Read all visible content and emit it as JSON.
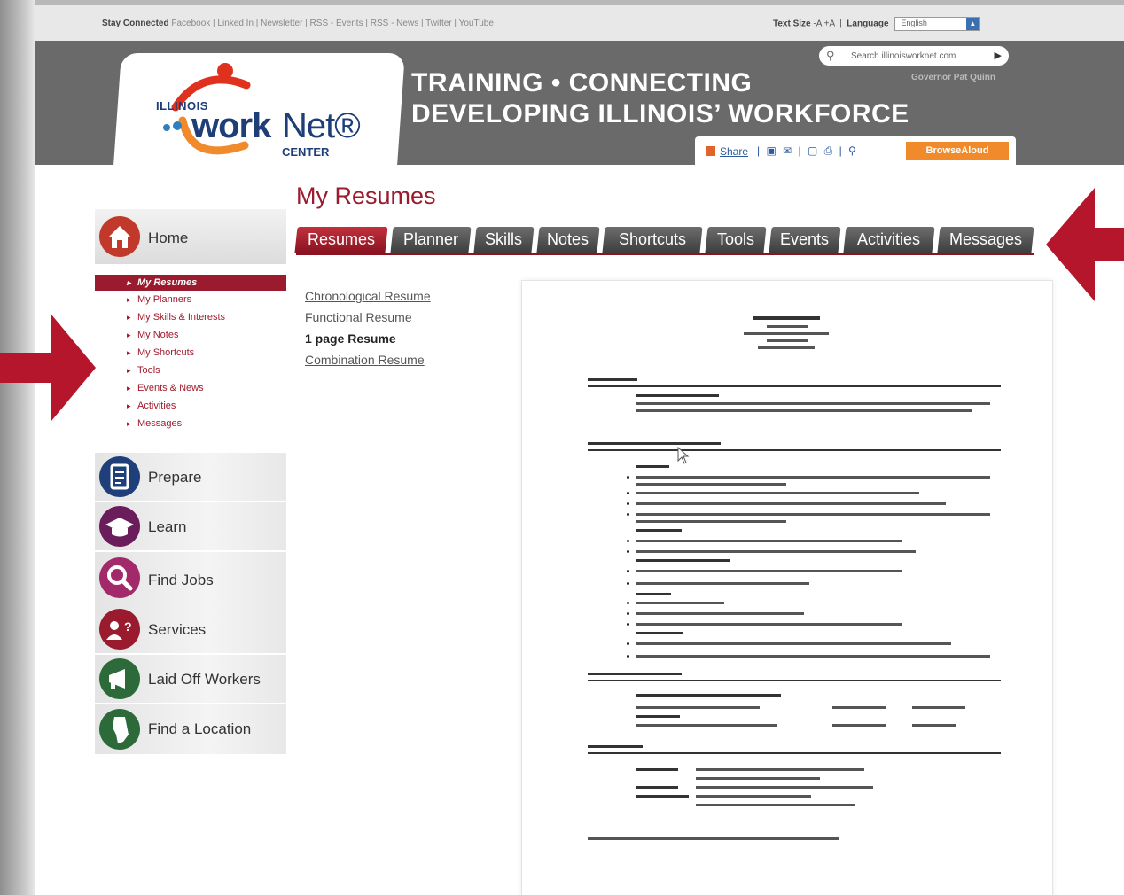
{
  "topbar": {
    "stay_connected": "Stay Connected",
    "links": "Facebook | Linked In | Newsletter | RSS - Events | RSS - News | Twitter | YouTube",
    "text_size_label": "Text Size",
    "text_size_controls": "-A +A",
    "language_label": "Language",
    "language_value": "English"
  },
  "banner": {
    "logo_illinois": "ILLINOIS",
    "logo_work": "work",
    "logo_net": "Net®",
    "logo_center": "CENTER",
    "tagline_line1": "TRAINING • CONNECTING",
    "tagline_line2": "DEVELOPING ILLINOIS’ WORKFORCE",
    "search_placeholder": "Search illinoisworknet.com",
    "governor": "Governor Pat Quinn",
    "share_label": "Share",
    "browse_aloud": "BrowseAloud"
  },
  "page_title": "My Resumes",
  "tabs": [
    {
      "label": "Resumes",
      "active": true
    },
    {
      "label": "Planner"
    },
    {
      "label": "Skills"
    },
    {
      "label": "Notes"
    },
    {
      "label": "Shortcuts"
    },
    {
      "label": "Tools"
    },
    {
      "label": "Events"
    },
    {
      "label": "Activities"
    },
    {
      "label": "Messages"
    }
  ],
  "sidebar": {
    "home": "Home",
    "subnav": [
      "My Resumes",
      "My Planners",
      "My Skills & Interests",
      "My Notes",
      "My Shortcuts",
      "Tools",
      "Events & News",
      "Activities",
      "Messages"
    ],
    "categories": [
      "Prepare",
      "Learn",
      "Find Jobs",
      "Services",
      "Laid Off Workers",
      "Find a Location"
    ]
  },
  "resume_links": [
    "Chronological Resume",
    "Functional Resume",
    "1 page Resume",
    "Combination Resume"
  ],
  "colors": {
    "brand_red": "#9b1b2e",
    "arrow_red": "#b5162b",
    "tab_gray": "#4f4f4f",
    "banner_gray": "#6a6a6a"
  }
}
